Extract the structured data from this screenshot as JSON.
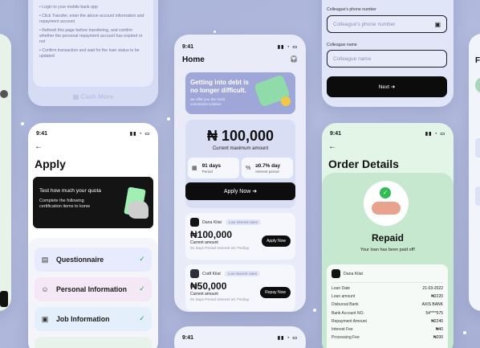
{
  "instructions": {
    "lines": [
      "• Login to your mobile bank app",
      "• Click Transfer,  enter the above account information and repayment account",
      "• Refresh this page before transfering, and confirm whether the personal repayment account has expired or not",
      "• Confirm transaction and wait for the loan status to be updated"
    ],
    "brand": "Cash More"
  },
  "status_time": "9:41",
  "apply_screen": {
    "title": "Apply",
    "quota_title": "Test how much your quota",
    "quota_desc": "Complete the following certification items to konw",
    "steps": [
      {
        "label": "Questionnaire",
        "icon": "questionnaire-icon",
        "bg": "#e8eafe",
        "done": true
      },
      {
        "label": "Personal Information",
        "icon": "person-id-icon",
        "bg": "#f4e8f7",
        "done": true
      },
      {
        "label": "Job Information",
        "icon": "briefcase-icon",
        "bg": "#e3effa",
        "done": true
      },
      {
        "label": "",
        "icon": "",
        "bg": "#e7f3ea",
        "done": true
      }
    ]
  },
  "home_screen": {
    "title": "Home",
    "banner_title": "Getting into debt is no longer difficult.",
    "banner_subtitle": "we offer you the most convenient solution",
    "amount": "₦ 100,000",
    "amount_label": "Current maximum amount",
    "period_value": "91 days",
    "period_label": "Period",
    "interest_value": "≥0.7% day",
    "interest_label": "Interest period",
    "apply_button": "Apply Now",
    "loans": [
      {
        "name": "Dana Kilat",
        "tag": "Low interest rates",
        "amount": "₦100,000",
        "label": "Current amount",
        "meta": "91 days Period     Interest ≥0.7%/day",
        "button": "Apply Now"
      },
      {
        "name": "Craft Kilat",
        "tag": "Low interest rates",
        "amount": "₦50,000",
        "label": "Current amount",
        "meta": "91 days Period     Interest ≥0.7%/day",
        "button": "Repay Now"
      }
    ]
  },
  "form_screen": {
    "phone_label": "Colleague's phone number",
    "phone_placeholder": "Colleague's phone number",
    "name_label": "Colleague name",
    "name_placeholder": "Colleague name",
    "next_button": "Next"
  },
  "order_screen": {
    "title": "Order Details",
    "status": "Repaid",
    "status_text": "Your loan has been paid off!",
    "provider": "Dana Kilat",
    "rows": [
      {
        "k": "Loan Date",
        "v": "21-03-2022"
      },
      {
        "k": "Loan amount",
        "v": "₦2220"
      },
      {
        "k": "Disbursal Bank",
        "v": "AXIS BANK"
      },
      {
        "k": "Bank Account NO.",
        "v": "54****575"
      },
      {
        "k": "Repayment Amount",
        "v": "₦2240"
      },
      {
        "k": "Interest Fee",
        "v": "₦40"
      },
      {
        "k": "Processing Fee",
        "v": "₦200"
      }
    ]
  },
  "edge_right_title": "F",
  "colors": {
    "accent_green": "#27b04c",
    "dark": "#0d0d0d",
    "lavender": "#a9b3d8"
  }
}
